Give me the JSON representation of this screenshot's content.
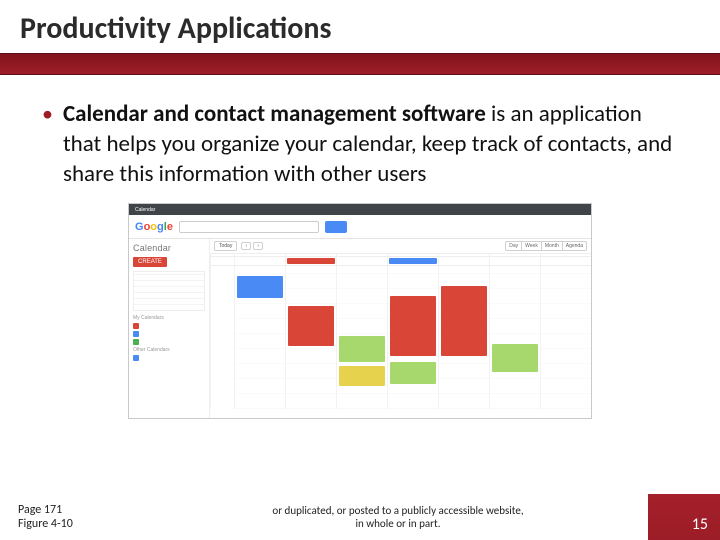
{
  "title": "Productivity Applications",
  "bullet": {
    "bold": "Calendar and contact management software",
    "rest": " is an application that helps you organize your calendar, keep track of contacts, and share this information with other users"
  },
  "figure": {
    "titlebar": {
      "tab": "Calendar",
      "right": ""
    },
    "logo": [
      "G",
      "o",
      "o",
      "g",
      "l",
      "e"
    ],
    "app_name": "Calendar",
    "create_label": "CREATE",
    "my_cals_label": "My Calendars",
    "other_cals_label": "Other Calendars",
    "cals": [
      {
        "swatch": "sw-red",
        "name": ""
      },
      {
        "swatch": "sw-blue",
        "name": ""
      },
      {
        "swatch": "sw-grn",
        "name": ""
      },
      {
        "swatch": "sw-blue",
        "name": ""
      }
    ],
    "toolbar": {
      "today": "Today",
      "prev": "‹",
      "next": "›",
      "range": "",
      "views": [
        "Day",
        "Week",
        "Month",
        "Agenda"
      ]
    },
    "events": {
      "allday_blue": "",
      "allday_red": ""
    }
  },
  "footer": {
    "page": "Page 171",
    "fig": "Figure 4-10",
    "legal1": "or duplicated, or posted to a publicly accessible website,",
    "legal2": "in whole or in part.",
    "slide_no": "15"
  }
}
